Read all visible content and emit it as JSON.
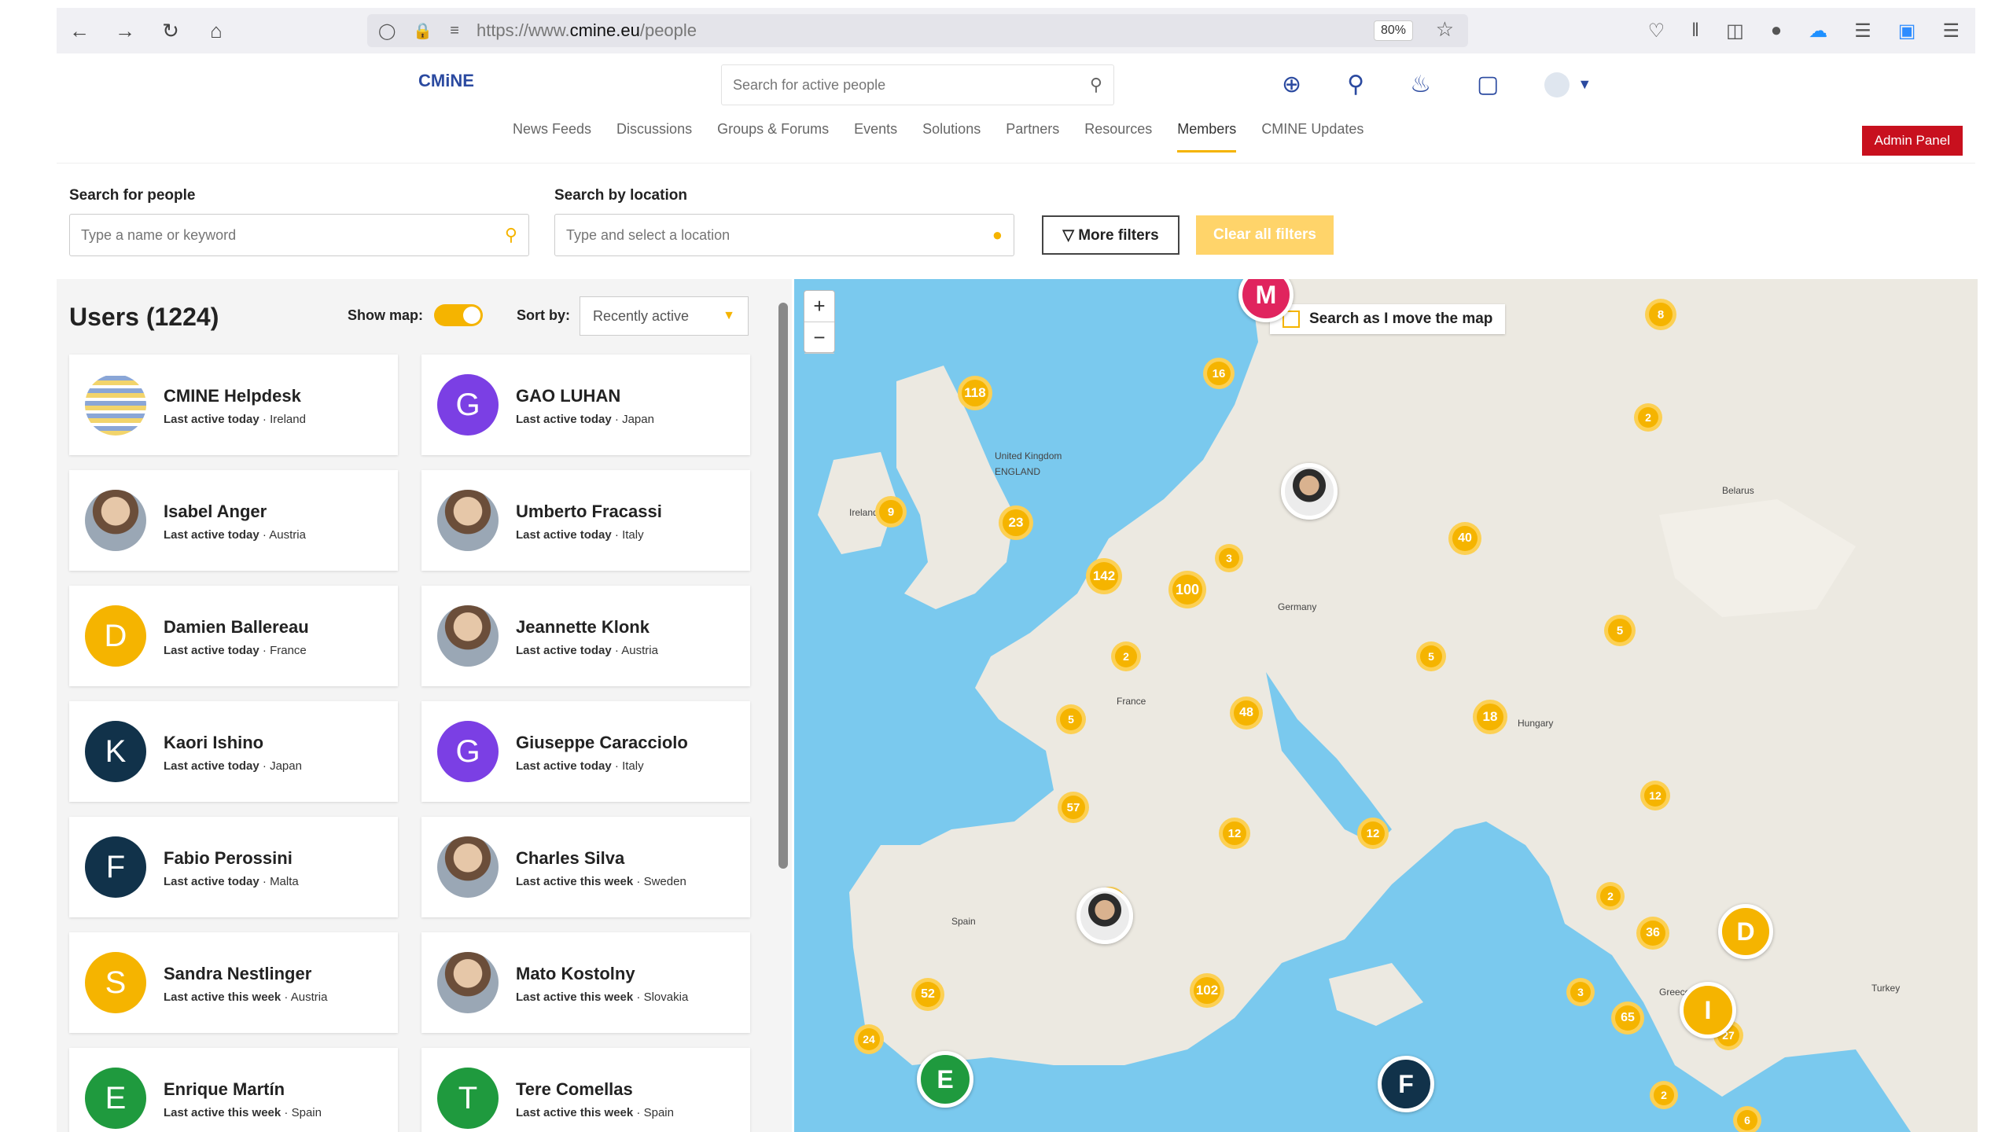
{
  "browser": {
    "url_prefix": "https://www.",
    "url_domain": "cmine.eu",
    "url_path": "/people",
    "zoom": "80%"
  },
  "header": {
    "logo_text": "CMiNE",
    "search_placeholder": "Search for active people",
    "nav": [
      "News Feeds",
      "Discussions",
      "Groups & Forums",
      "Events",
      "Solutions",
      "Partners",
      "Resources",
      "Members",
      "CMINE Updates"
    ],
    "active_nav": "Members",
    "admin_label": "Admin Panel"
  },
  "filters": {
    "people_label": "Search for people",
    "people_placeholder": "Type a name or keyword",
    "location_label": "Search by location",
    "location_placeholder": "Type and select a location",
    "more_filters": "More filters",
    "clear_filters": "Clear all filters"
  },
  "list": {
    "title": "Users (1224)",
    "show_map_label": "Show map:",
    "sort_label": "Sort by:",
    "sort_value": "Recently active",
    "users": [
      {
        "name": "CMINE Helpdesk",
        "activity": "Last active today",
        "country": "Ireland",
        "avatar": "logo",
        "color": ""
      },
      {
        "name": "GAO LUHAN",
        "activity": "Last active today",
        "country": "Japan",
        "avatar": "G",
        "color": "#7b3fe4"
      },
      {
        "name": "Isabel Anger",
        "activity": "Last active today",
        "country": "Austria",
        "avatar": "photo",
        "color": ""
      },
      {
        "name": "Umberto Fracassi",
        "activity": "Last active today",
        "country": "Italy",
        "avatar": "photo",
        "color": ""
      },
      {
        "name": "Damien Ballereau",
        "activity": "Last active today",
        "country": "France",
        "avatar": "D",
        "color": "#f5b400"
      },
      {
        "name": "Jeannette Klonk",
        "activity": "Last active today",
        "country": "Austria",
        "avatar": "photo",
        "color": ""
      },
      {
        "name": "Kaori Ishino",
        "activity": "Last active today",
        "country": "Japan",
        "avatar": "K",
        "color": "#11324a"
      },
      {
        "name": "Giuseppe Caracciolo",
        "activity": "Last active today",
        "country": "Italy",
        "avatar": "G",
        "color": "#7b3fe4"
      },
      {
        "name": "Fabio Perossini",
        "activity": "Last active today",
        "country": "Malta",
        "avatar": "F",
        "color": "#11324a"
      },
      {
        "name": "Charles Silva",
        "activity": "Last active this week",
        "country": "Sweden",
        "avatar": "photo",
        "color": ""
      },
      {
        "name": "Sandra Nestlinger",
        "activity": "Last active this week",
        "country": "Austria",
        "avatar": "S",
        "color": "#f5b400"
      },
      {
        "name": "Mato Kostolny",
        "activity": "Last active this week",
        "country": "Slovakia",
        "avatar": "photo",
        "color": ""
      },
      {
        "name": "Enrique Martín",
        "activity": "Last active this week",
        "country": "Spain",
        "avatar": "E",
        "color": "#1f9a3e"
      },
      {
        "name": "Tere Comellas",
        "activity": "Last active this week",
        "country": "Spain",
        "avatar": "T",
        "color": "#1f9a3e"
      }
    ]
  },
  "map": {
    "search_move_label": "Search as I move the map",
    "clusters": [
      "8",
      "16",
      "118",
      "2",
      "9",
      "23",
      "3",
      "40",
      "142",
      "100",
      "2",
      "5",
      "5",
      "5",
      "18",
      "48",
      "57",
      "12",
      "12",
      "12",
      "3",
      "2",
      "36",
      "102",
      "3",
      "65",
      "24",
      "52",
      "27",
      "2",
      "6"
    ],
    "pins": [
      {
        "letter": "M",
        "color": "#e0245e"
      },
      {
        "letter": "",
        "color": "photo"
      },
      {
        "letter": "",
        "color": "photo"
      },
      {
        "letter": "D",
        "color": "#f5b400"
      },
      {
        "letter": "I",
        "color": "#f5b400"
      },
      {
        "letter": "E",
        "color": "#1f9a3e"
      },
      {
        "letter": "F",
        "color": "#11324a"
      }
    ],
    "labels": [
      "United Kingdom",
      "ENGLAND",
      "Belarus",
      "France",
      "Spain",
      "Hungary",
      "Turkey",
      "Greece",
      "Germany",
      "Ireland"
    ]
  },
  "icons": {
    "back": "arrow-left-icon",
    "forward": "arrow-right-icon",
    "reload": "reload-icon",
    "home": "home-icon",
    "add": "plus-circle-icon",
    "location": "pin-icon",
    "bell": "bell-icon",
    "chat": "chat-icon"
  }
}
